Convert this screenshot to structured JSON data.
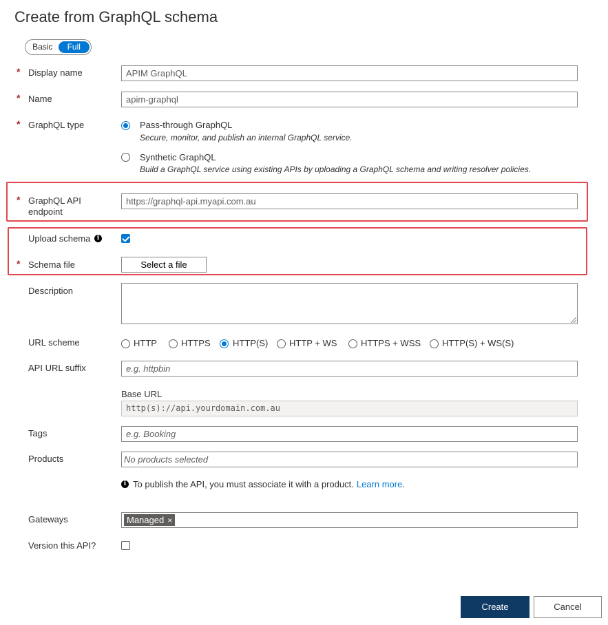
{
  "title": "Create from GraphQL schema",
  "mode_toggle": {
    "options": [
      "Basic",
      "Full"
    ],
    "selected": "Full"
  },
  "fields": {
    "display_name": {
      "label": "Display name",
      "value": "APIM GraphQL"
    },
    "name": {
      "label": "Name",
      "value": "apim-graphql"
    },
    "graphql_type": {
      "label": "GraphQL type",
      "options": [
        {
          "label": "Pass-through GraphQL",
          "description": "Secure, monitor, and publish an internal GraphQL service.",
          "selected": true
        },
        {
          "label": "Synthetic GraphQL",
          "description": "Build a GraphQL service using existing APIs by uploading a GraphQL schema and writing resolver policies.",
          "selected": false
        }
      ]
    },
    "endpoint": {
      "label_line1": "GraphQL API",
      "label_line2": "endpoint",
      "value": "https://graphql-api.myapi.com.au"
    },
    "upload_schema": {
      "label": "Upload schema",
      "checked": true
    },
    "schema_file": {
      "label": "Schema file",
      "button": "Select a file"
    },
    "description": {
      "label": "Description",
      "value": ""
    },
    "url_scheme": {
      "label": "URL scheme",
      "options": [
        "HTTP",
        "HTTPS",
        "HTTP(S)",
        "HTTP + WS",
        "HTTPS + WSS",
        "HTTP(S) + WS(S)"
      ],
      "selected": "HTTP(S)"
    },
    "api_url_suffix": {
      "label": "API URL suffix",
      "placeholder": "e.g. httpbin"
    },
    "base_url": {
      "label": "Base URL",
      "value": "http(s)://api.yourdomain.com.au"
    },
    "tags": {
      "label": "Tags",
      "placeholder": "e.g. Booking"
    },
    "products": {
      "label": "Products",
      "placeholder": "No products selected"
    },
    "products_notice": {
      "text": "To publish the API, you must associate it with a product.",
      "link": "Learn more",
      "suffix": "."
    },
    "gateways": {
      "label": "Gateways",
      "tag": "Managed",
      "remove": "×"
    },
    "version_api": {
      "label": "Version this API?",
      "checked": false
    }
  },
  "actions": {
    "create": "Create",
    "cancel": "Cancel"
  },
  "colors": {
    "accent": "#0078d4",
    "primary_button": "#0f3a64",
    "required": "#a4262c",
    "highlight": "#e0484f"
  },
  "required_marker": "*",
  "info_glyph": "i"
}
